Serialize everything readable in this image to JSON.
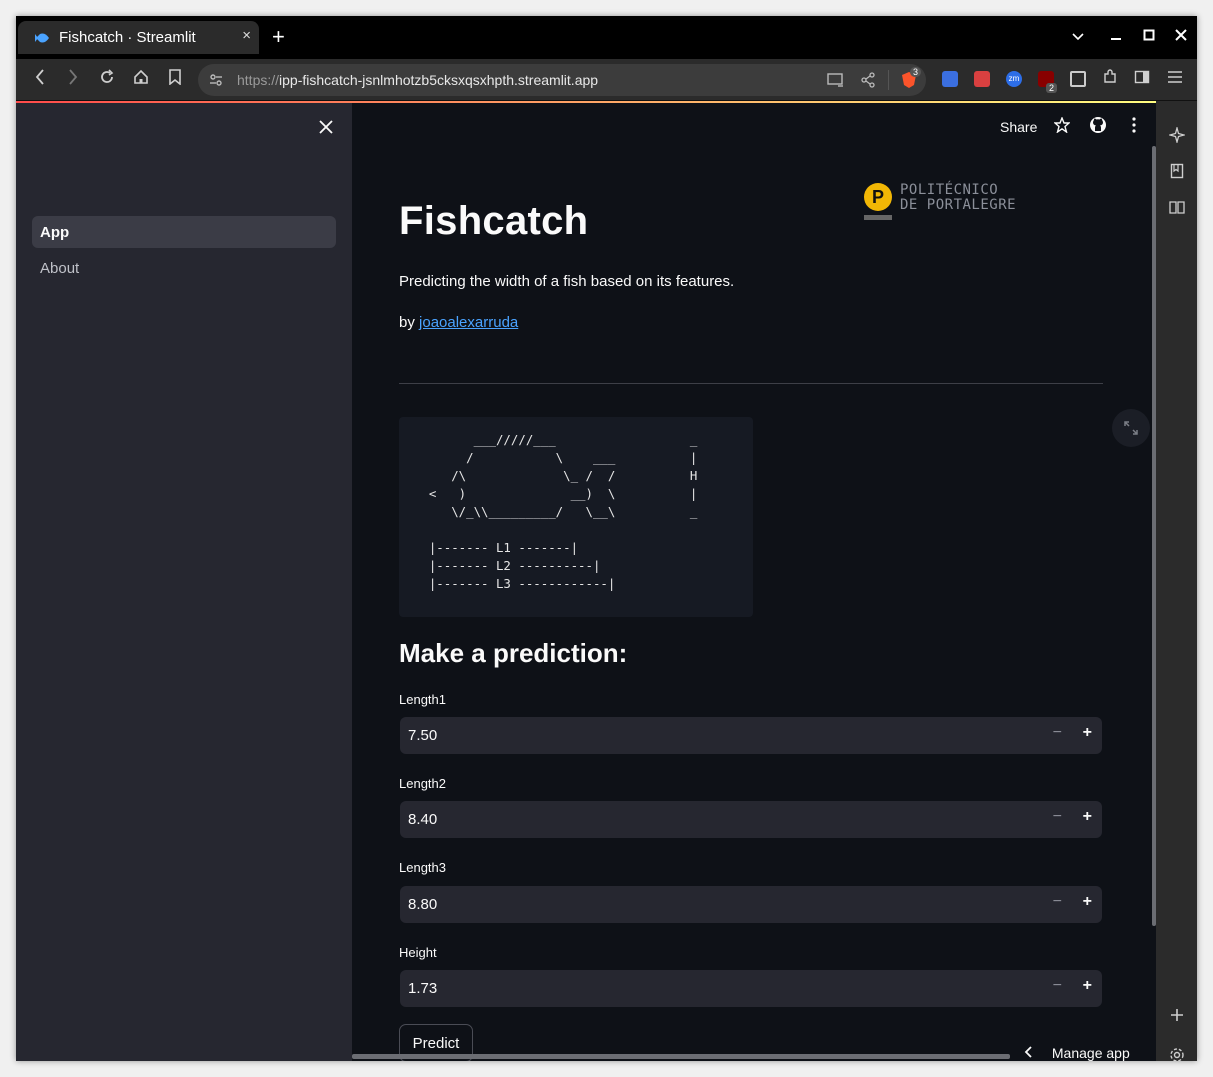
{
  "browser": {
    "tab_title": "Fishcatch · Streamlit",
    "tab_close": "×",
    "new_tab": "+",
    "url_prefix": "https://",
    "url_host": "ipp-fishcatch-jsnlmhotzb5cksxqsxhpth.streamlit.app",
    "shield_count": "3",
    "ublock_count": "2",
    "zm_label": "zm"
  },
  "sidebar": {
    "items": [
      {
        "label": "App",
        "active": true
      },
      {
        "label": "About",
        "active": false
      }
    ]
  },
  "header": {
    "share_label": "Share"
  },
  "logo": {
    "letter": "P",
    "line1": "POLITÉCNICO",
    "line2": "DE PORTALEGRE"
  },
  "main": {
    "title": "Fishcatch",
    "subtitle": "Predicting the width of a fish based on its features.",
    "by_prefix": "by",
    "author_link": "joaoalexarruda",
    "ascii_art": "          ___/////___                  _\n         /           \\    ___          |\n       /\\             \\_ /  /          H\n    <   )              __)  \\          |\n       \\/_\\\\_________/   \\__\\          _\n\n    |------- L1 -------|\n    |------- L2 ----------|\n    |------- L3 ------------|",
    "section_heading": "Make a prediction:",
    "inputs": [
      {
        "label": "Length1",
        "value": "7.50"
      },
      {
        "label": "Length2",
        "value": "8.40"
      },
      {
        "label": "Length3",
        "value": "8.80"
      },
      {
        "label": "Height",
        "value": "1.73"
      }
    ],
    "predict_label": "Predict",
    "manage_app_label": "Manage app"
  },
  "colors": {
    "background": "#0e1117",
    "sidebar": "#262730",
    "link": "#4aa3ff",
    "accent_start": "#ff4b4b",
    "accent_end": "#fffd80"
  }
}
